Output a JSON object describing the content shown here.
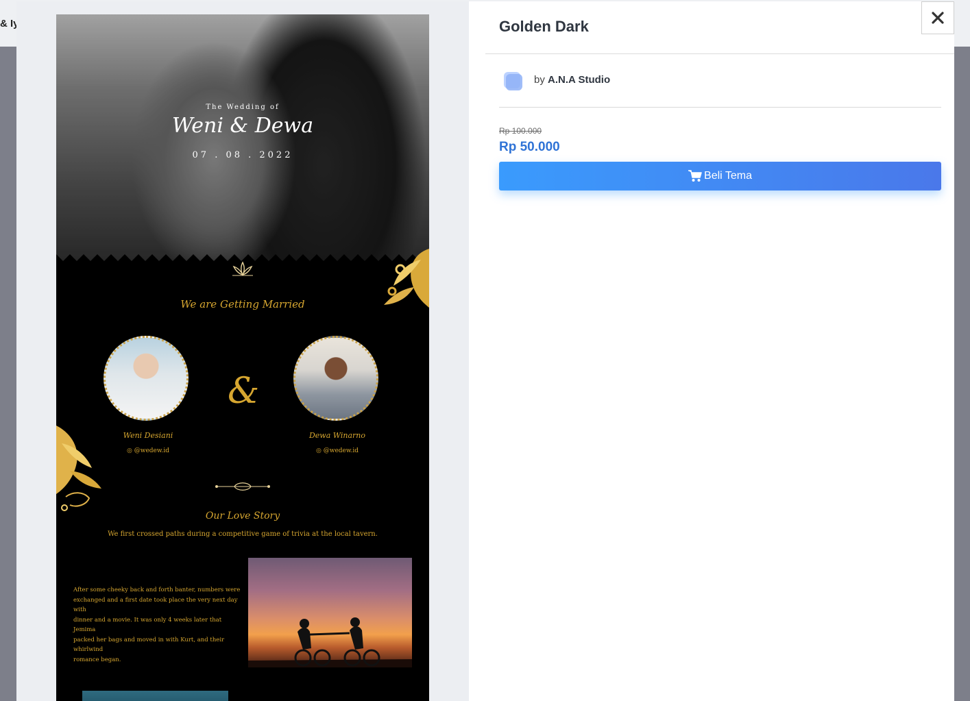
{
  "background": {
    "peek_text": "& Iy"
  },
  "preview": {
    "hero": {
      "the_wedding_of": "The Wedding of",
      "couple": "Weni & Dewa",
      "date": "07 . 08 . 2022"
    },
    "married_heading": "We are Getting Married",
    "bride": {
      "name": "Weni Desiani",
      "handle": "@wedew.id"
    },
    "groom": {
      "name": "Dewa Winarno",
      "handle": "@wedew.id"
    },
    "ampersand": "&",
    "love_story": {
      "title": "Our Love Story",
      "subtitle": "We first crossed paths during a competitive game of trivia at the local tavern.",
      "lines": [
        "After some cheeky back and forth banter, numbers were",
        "exchanged and a first date took place the very next day with",
        "dinner and a movie. It was only 4 weeks later that Jemima",
        "packed her bags and moved in with Kurt, and their whirlwind",
        "romance began."
      ]
    }
  },
  "details": {
    "title": "Golden Dark",
    "author_prefix": "by",
    "author_name": "A.N.A Studio",
    "old_price": "Rp 100.000",
    "price": "Rp 50.000",
    "buy_label": "Beli Tema"
  },
  "colors": {
    "gold": "#d6a630",
    "accent": "#2f73d6",
    "button_start": "#3a9bfd",
    "button_end": "#4a78ea"
  }
}
